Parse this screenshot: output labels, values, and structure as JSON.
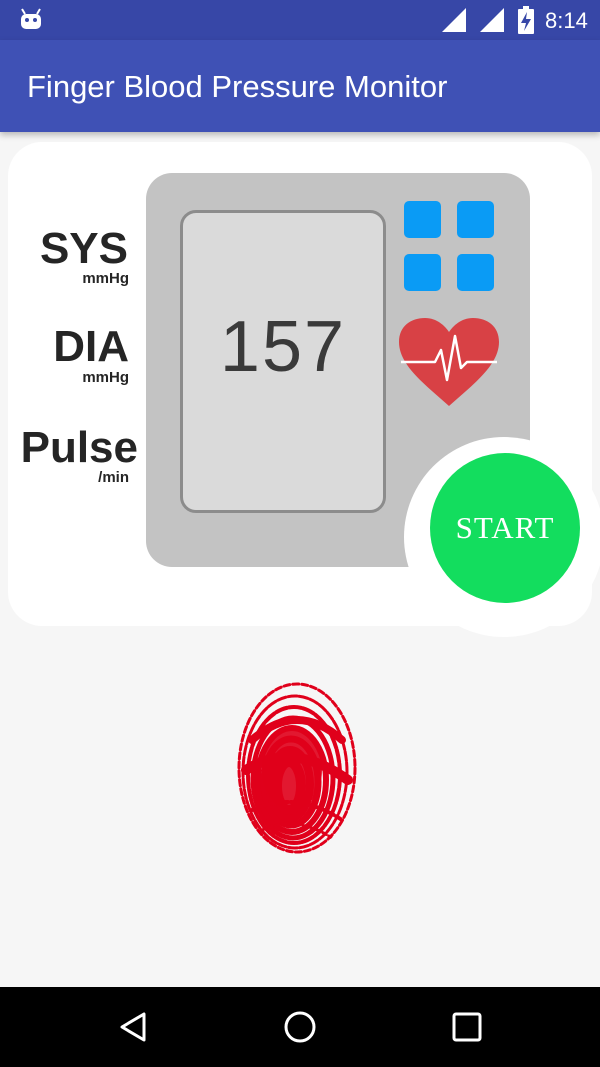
{
  "status_bar": {
    "time": "8:14",
    "icons": [
      "android-debug-icon",
      "cell-signal-icon",
      "wifi-signal-icon",
      "battery-charging-icon"
    ]
  },
  "app_bar": {
    "title": "Finger Blood Pressure Monitor"
  },
  "monitor": {
    "sys_label": "SYS",
    "sys_unit": "mmHg",
    "dia_label": "DIA",
    "dia_unit": "mmHg",
    "pulse_label": "Pulse",
    "pulse_unit": "/min",
    "reading": "157",
    "start_label": "START"
  },
  "colors": {
    "status_bar": "#3747a7",
    "app_bar": "#3f51b5",
    "start_button": "#13dd5e",
    "tiles": "#0a9bf5",
    "heart": "#d84145",
    "fingerprint": "#e0001b"
  },
  "nav_bar": {
    "icons": [
      "back-icon",
      "home-icon",
      "recents-icon"
    ]
  }
}
